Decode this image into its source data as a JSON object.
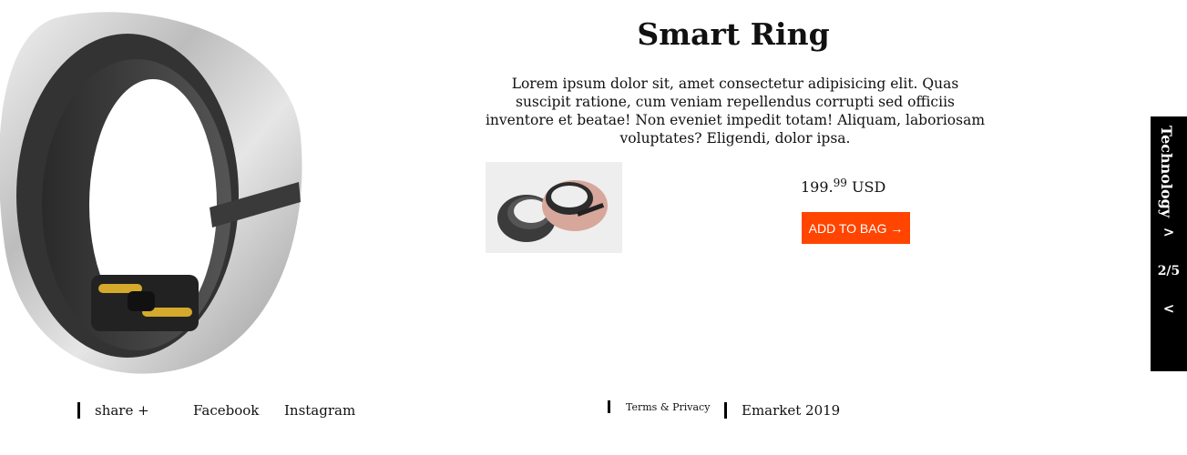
{
  "product": {
    "title": "Smart Ring",
    "description": "Lorem ipsum dolor sit, amet consectetur adipisicing elit. Quas suscipit ratione, cum veniam repellendus corrupti sed officiis inventore et beatae! Non eveniet impedit totam! Aliquam, laboriosam voluptates? Eligendi, dolor ipsa.",
    "price_whole": "199.",
    "price_cents": "99",
    "currency": "USD",
    "add_to_bag_label": "ADD TO BAG →"
  },
  "category_panel": {
    "category": "Technology",
    "next_icon": ">",
    "page_indicator": "2/5",
    "prev_icon": "<"
  },
  "footer": {
    "share_label": "share +",
    "facebook_label": "Facebook",
    "instagram_label": "Instagram",
    "terms_label": "Terms & Privacy",
    "copyright": "Emarket 2019"
  },
  "colors": {
    "accent": "#ff4500",
    "panel": "#000000",
    "background": "#ffffff"
  }
}
